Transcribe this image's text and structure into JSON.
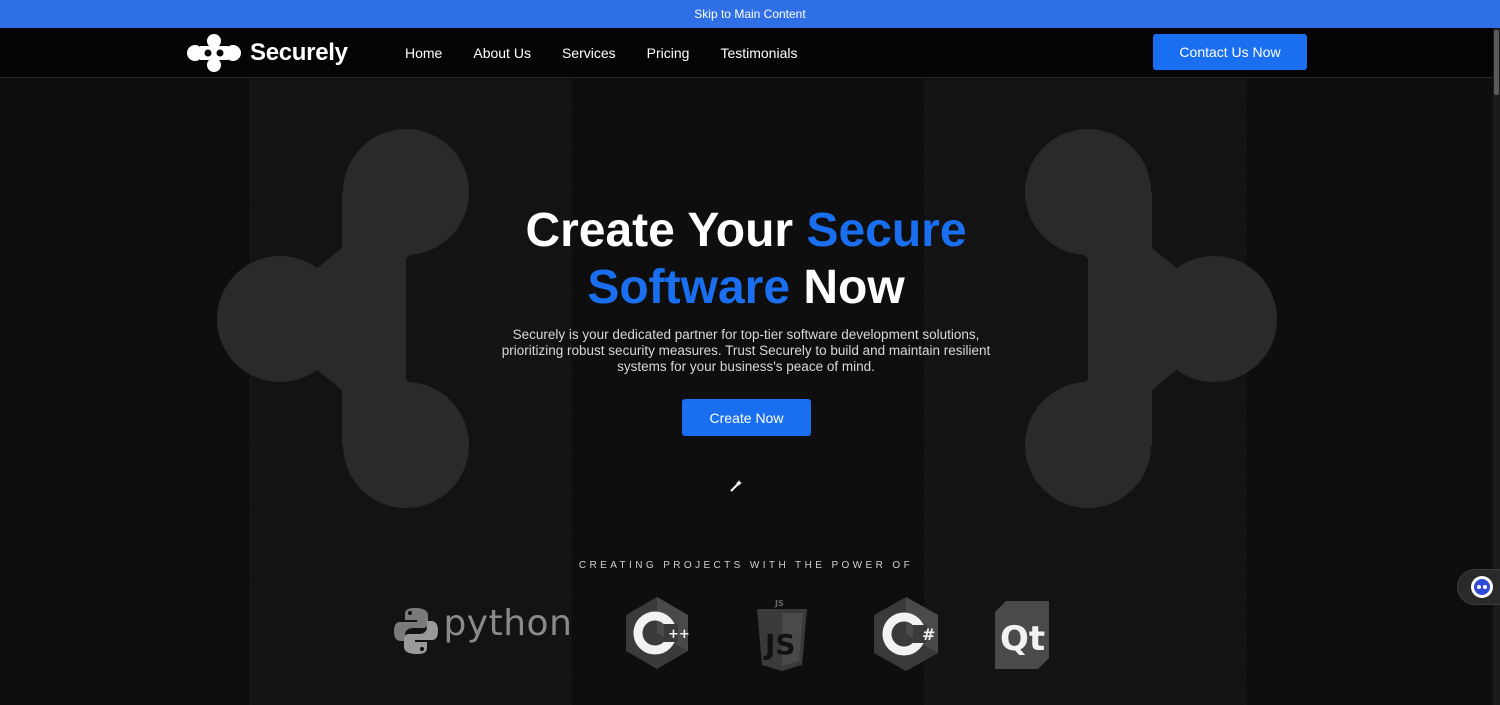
{
  "skip_link": "Skip to Main Content",
  "brand": {
    "name": "Securely",
    "accent_color": "#1a6ff0"
  },
  "nav": {
    "items": [
      {
        "label": "Home"
      },
      {
        "label": "About Us"
      },
      {
        "label": "Services"
      },
      {
        "label": "Pricing"
      },
      {
        "label": "Testimonials"
      }
    ],
    "cta": "Contact Us Now"
  },
  "hero": {
    "title_part1": "Create Your ",
    "title_accent1": "Secure",
    "title_accent2": "Software",
    "title_part2": " Now",
    "description": "Securely is your dedicated partner for top-tier software development solutions, prioritizing robust security measures. Trust Securely to build and maintain resilient systems for your business's peace of mind.",
    "button": "Create Now"
  },
  "tech": {
    "heading": "CREATING PROJECTS WITH THE POWER OF",
    "logos": [
      {
        "name": "python-icon",
        "label": "python"
      },
      {
        "name": "cpp-icon",
        "label": "C++"
      },
      {
        "name": "javascript-icon",
        "label": "JS"
      },
      {
        "name": "csharp-icon",
        "label": "C#"
      },
      {
        "name": "qt-icon",
        "label": "Qt"
      }
    ]
  }
}
